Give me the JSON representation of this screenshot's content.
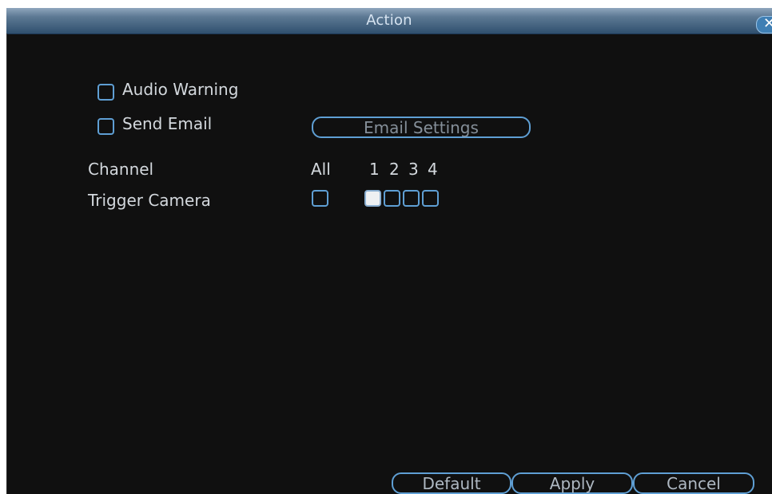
{
  "dialog": {
    "title": "Action",
    "close_symbol": "✕"
  },
  "options": {
    "audio_warning": {
      "label": "Audio Warning",
      "checked": false
    },
    "send_email": {
      "label": "Send Email",
      "checked": false
    },
    "email_settings_label": "Email Settings"
  },
  "channels": {
    "label": "Channel",
    "headers": [
      "All",
      "1",
      "2",
      "3",
      "4"
    ],
    "trigger_label": "Trigger Camera",
    "trigger_all_checked": false,
    "trigger_checked": [
      true,
      false,
      false,
      false
    ]
  },
  "footer": {
    "default_label": "Default",
    "apply_label": "Apply",
    "cancel_label": "Cancel"
  },
  "colors": {
    "background": "#101010",
    "accent": "#5f9fd4",
    "title_bar": "#4a6a88"
  }
}
